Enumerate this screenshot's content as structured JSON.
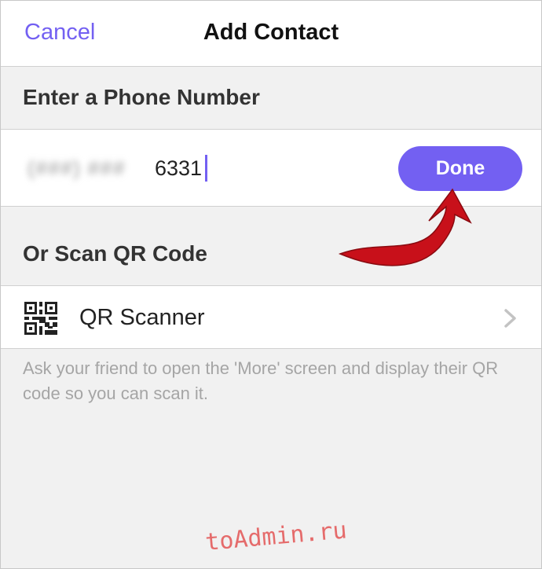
{
  "navbar": {
    "cancel_label": "Cancel",
    "title": "Add Contact"
  },
  "phone_section": {
    "header": "Enter a Phone Number",
    "blurred_prefix": "(###) ###",
    "visible_digits": "6331",
    "done_label": "Done"
  },
  "qr_section": {
    "header": "Or Scan QR Code",
    "scanner_label": "QR Scanner",
    "scanner_icon": "qr-code-icon",
    "chevron_icon": "chevron-right-icon",
    "hint": "Ask your friend to open the 'More' screen and display their QR code so you can scan it."
  },
  "annotation": {
    "arrow_icon": "red-arrow-icon",
    "arrow_color": "#c8101a"
  },
  "watermark": "toAdmin.ru",
  "colors": {
    "accent": "#7360f2",
    "background": "#f1f1f1",
    "hint_text": "#a5a5a5"
  }
}
